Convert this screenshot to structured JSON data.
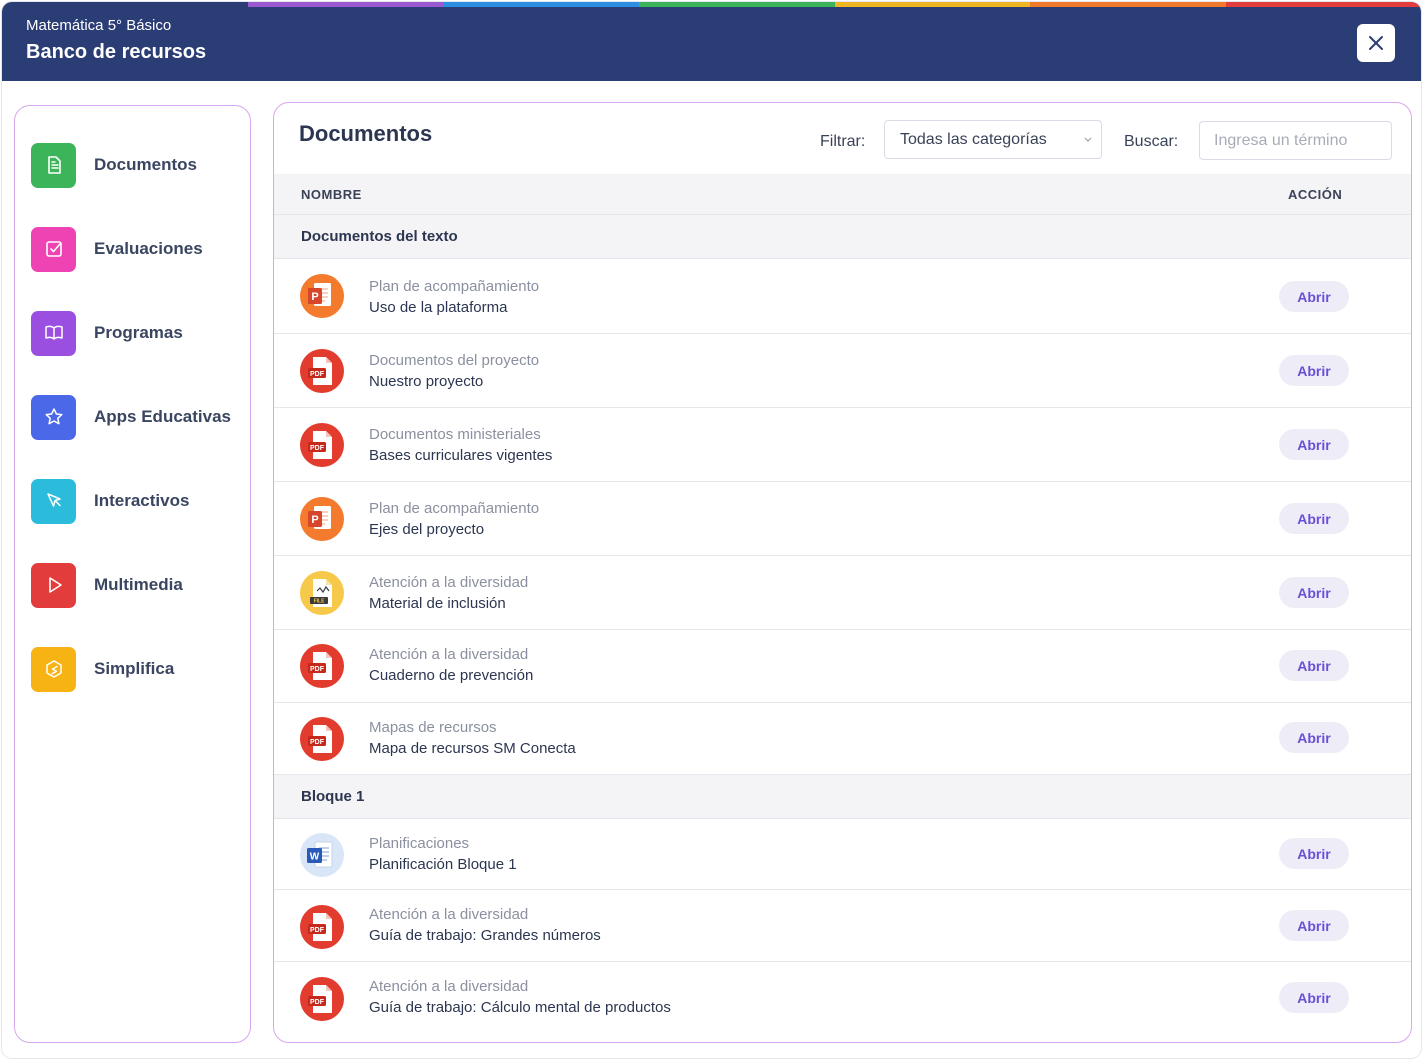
{
  "header": {
    "subtitle": "Matemática 5° Básico",
    "title": "Banco de recursos",
    "rainbow_colors": [
      "#9b59d0",
      "#2a8fe0",
      "#3cb55a",
      "#f0b522",
      "#f07a2a",
      "#e23c3c"
    ]
  },
  "sidebar": {
    "items": [
      {
        "label": "Documentos",
        "icon": "document-icon",
        "color": "#3cb55a"
      },
      {
        "label": "Evaluaciones",
        "icon": "checkbox-icon",
        "color": "#ee44b3"
      },
      {
        "label": "Programas",
        "icon": "book-icon",
        "color": "#9b4fe0"
      },
      {
        "label": "Apps Educativas",
        "icon": "star-icon",
        "color": "#4a68e8"
      },
      {
        "label": "Interactivos",
        "icon": "cursor-icon",
        "color": "#2bbcdc"
      },
      {
        "label": "Multimedia",
        "icon": "play-icon",
        "color": "#e23c3c"
      },
      {
        "label": "Simplifica",
        "icon": "simplifica-icon",
        "color": "#f7b214"
      }
    ]
  },
  "main": {
    "title": "Documentos",
    "filter_label": "Filtrar:",
    "filter_value": "Todas las categorías",
    "search_label": "Buscar:",
    "search_placeholder": "Ingresa un término",
    "col_name": "NOMBRE",
    "col_action": "ACCIÓN",
    "open_label": "Abrir",
    "sections": [
      {
        "title": "Documentos del texto",
        "rows": [
          {
            "category": "Plan de acompañamiento",
            "name": "Uso de la plataforma",
            "type": "ppt-icon"
          },
          {
            "category": "Documentos del proyecto",
            "name": "Nuestro proyecto",
            "type": "pdf-icon"
          },
          {
            "category": "Documentos ministeriales",
            "name": "Bases curriculares vigentes",
            "type": "pdf-icon"
          },
          {
            "category": "Plan de acompañamiento",
            "name": "Ejes del proyecto",
            "type": "ppt-icon"
          },
          {
            "category": "Atención a la diversidad",
            "name": "Material de inclusión",
            "type": "file-icon"
          },
          {
            "category": "Atención a la diversidad",
            "name": "Cuaderno de prevención",
            "type": "pdf-icon"
          },
          {
            "category": "Mapas de recursos",
            "name": "Mapa de recursos SM Conecta",
            "type": "pdf-icon"
          }
        ]
      },
      {
        "title": "Bloque 1",
        "rows": [
          {
            "category": "Planificaciones",
            "name": "Planificación Bloque 1",
            "type": "word-icon"
          },
          {
            "category": "Atención a la diversidad",
            "name": "Guía de trabajo: Grandes números",
            "type": "pdf-icon"
          },
          {
            "category": "Atención a la diversidad",
            "name": "Guía de trabajo: Cálculo mental de productos",
            "type": "pdf-icon"
          }
        ]
      }
    ]
  }
}
